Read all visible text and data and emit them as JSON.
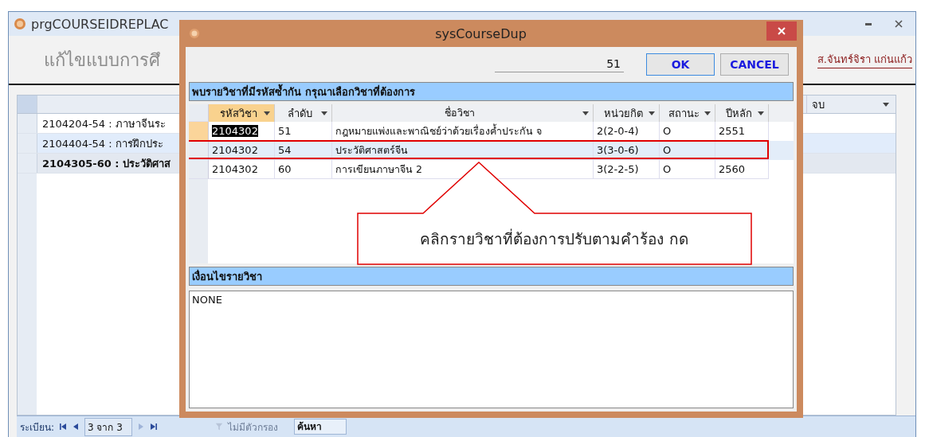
{
  "window": {
    "title": "prgCOURSEIDREPLAC",
    "heading": "แก้ไขแบบการศึ",
    "user": "ส.จันทร์จิรา แก่นแก้ว"
  },
  "list": {
    "column_header": "จบ",
    "rows": [
      {
        "text": "2104204-54 : ภาษาจีนระ",
        "selected": false
      },
      {
        "text": "2104404-54 : การฝึกประ",
        "selected": false
      },
      {
        "text": "2104305-60 : ประวัติศาส",
        "selected": true
      }
    ]
  },
  "status_bar": {
    "label": "ระเบียน:",
    "record": "3 จาก 3",
    "filter": "ไม่มีตัวกรอง",
    "search_placeholder": "ค้นหา"
  },
  "dialog": {
    "title": "sysCourseDup",
    "value": "51",
    "buttons": [
      {
        "label": "OK"
      },
      {
        "label": "CANCEL"
      }
    ],
    "grid_caption": "พบรายวิชาที่มีรหัสซ้ำกัน  กรุณาเลือกวิชาที่ต้องการ",
    "columns": [
      {
        "label": "รหัสวิชา",
        "sorted": true
      },
      {
        "label": "ลำดับ",
        "sorted": false
      },
      {
        "label": "ชื่อวิชา",
        "sorted": false
      },
      {
        "label": "หน่วยกิต",
        "sorted": false
      },
      {
        "label": "สถานะ",
        "sorted": false
      },
      {
        "label": "ปีหลัก",
        "sorted": false
      }
    ],
    "rows": [
      {
        "cells": [
          "2104302",
          "51",
          "กฎหมายแพ่งและพาณิชย์ว่าด้วยเรื่องค้ำประกัน จ",
          "2(2-0-4)",
          "O",
          "2551"
        ],
        "selected": true,
        "annotated": false
      },
      {
        "cells": [
          "2104302",
          "54",
          "ประวัติศาสตร์จีน",
          "3(3-0-6)",
          "O",
          ""
        ],
        "selected": false,
        "annotated": true
      },
      {
        "cells": [
          "2104302",
          "60",
          "การเขียนภาษาจีน 2",
          "3(2-2-5)",
          "O",
          "2560"
        ],
        "selected": false,
        "annotated": false
      }
    ],
    "conditions_caption": "เงื่อนไขรายวิชา",
    "conditions": "NONE"
  },
  "callout": {
    "text": "คลิกรายวิชาที่ต้องการปรับตามคำร้อง กด"
  }
}
